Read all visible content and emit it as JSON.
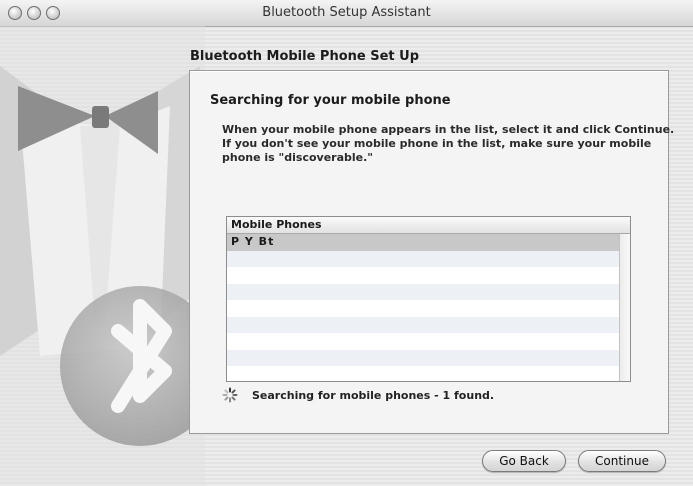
{
  "window": {
    "title": "Bluetooth Setup Assistant"
  },
  "page": {
    "heading": "Bluetooth Mobile Phone Set Up"
  },
  "panel": {
    "subtitle": "Searching for your mobile phone",
    "instructions": [
      "When your mobile phone appears in the list, select it and click Continue.",
      "If you don't see your mobile phone in the list, make sure your mobile",
      "phone is \"discoverable.\""
    ],
    "list": {
      "header": "Mobile Phones",
      "items": [
        "P Y  Bt"
      ],
      "selected_index": 0
    },
    "status": {
      "text": "Searching for mobile phones - 1 found."
    }
  },
  "buttons": {
    "back": "Go Back",
    "continue": "Continue"
  },
  "colors": {
    "selection": "#c8c8c8",
    "panel_bg": "#f4f4f4",
    "row_stripe": "#edf0f4"
  },
  "icons": [
    "window-close-icon",
    "window-minimize-icon",
    "window-zoom-icon",
    "bluetooth-logo-icon",
    "progress-spinner-icon"
  ]
}
